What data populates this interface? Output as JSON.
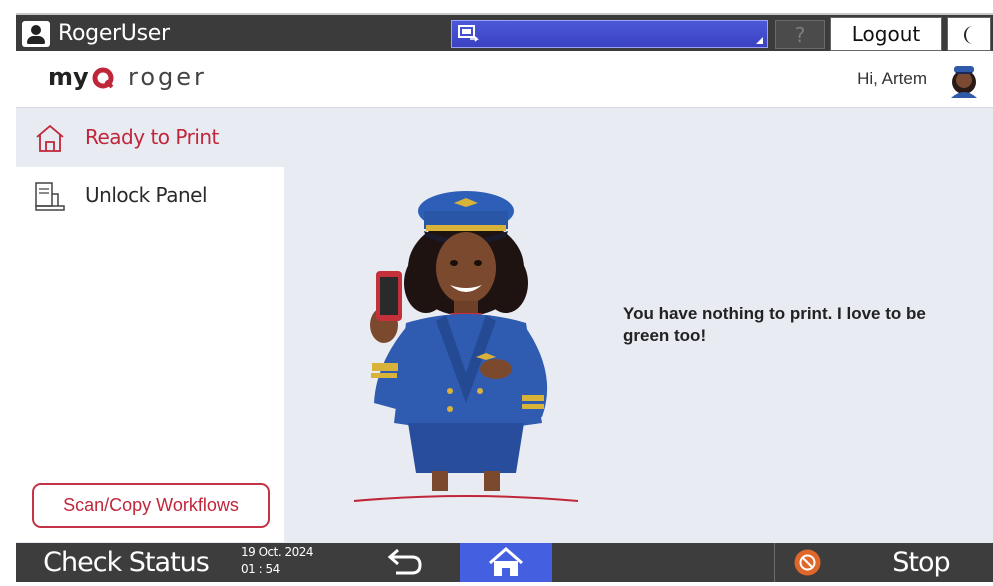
{
  "topbar": {
    "username": "RogerUser",
    "help_label": "?",
    "logout_label": "Logout"
  },
  "header": {
    "logo_text": "myq roger",
    "greeting": "Hi, Artem"
  },
  "sidebar": {
    "items": [
      {
        "label": "Ready to Print",
        "icon": "home-outline-icon",
        "active": true
      },
      {
        "label": "Unlock Panel",
        "icon": "printer-panel-icon",
        "active": false
      }
    ],
    "workflows_button": "Scan/Copy Workflows"
  },
  "main": {
    "message": "You have nothing to print. I love to be green too!"
  },
  "bottombar": {
    "check_status": "Check Status",
    "date": "19 Oct. 2024",
    "time": "01 : 54",
    "stop_label": "Stop"
  },
  "colors": {
    "accent_red": "#c0263a",
    "topbar_dark": "#3b3b3b",
    "select_blue": "#4c58d8",
    "home_blue": "#4460e0",
    "stop_orange": "#e0672a",
    "background": "#e9ebf2"
  }
}
